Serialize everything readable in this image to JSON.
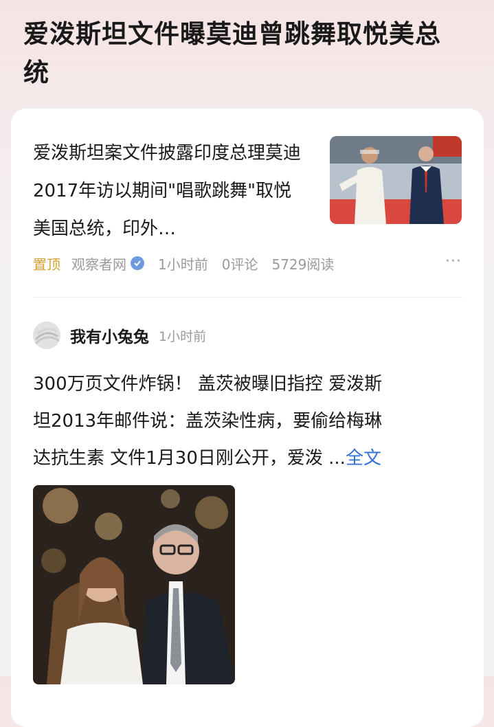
{
  "header": {
    "title": "爱泼斯坦文件曝莫迪曾跳舞取悦美总统"
  },
  "news": {
    "title": "爱泼斯坦案文件披露印度总理莫迪2017年访以期间\"唱歌跳舞\"取悦美国总统，印外…",
    "pin_label": "置顶",
    "source": "观察者网",
    "time": "1小时前",
    "comments": "0评论",
    "reads": "5729阅读",
    "more_icon": "more-dots-icon"
  },
  "post": {
    "author": "我有小兔兔",
    "time": "1小时前",
    "lines": [
      "300万页文件炸锅！ 盖茨被曝旧指控 爱泼斯",
      "坦2013年邮件说：盖茨染性病，要偷给梅琳",
      "达抗生素 文件1月30日刚公开，爱泼  ..."
    ],
    "read_more": "全文"
  },
  "colors": {
    "pin": "#d9a037",
    "link": "#2f6fd6",
    "verified": "#6e9ae0",
    "meta": "#9a9a9a"
  }
}
